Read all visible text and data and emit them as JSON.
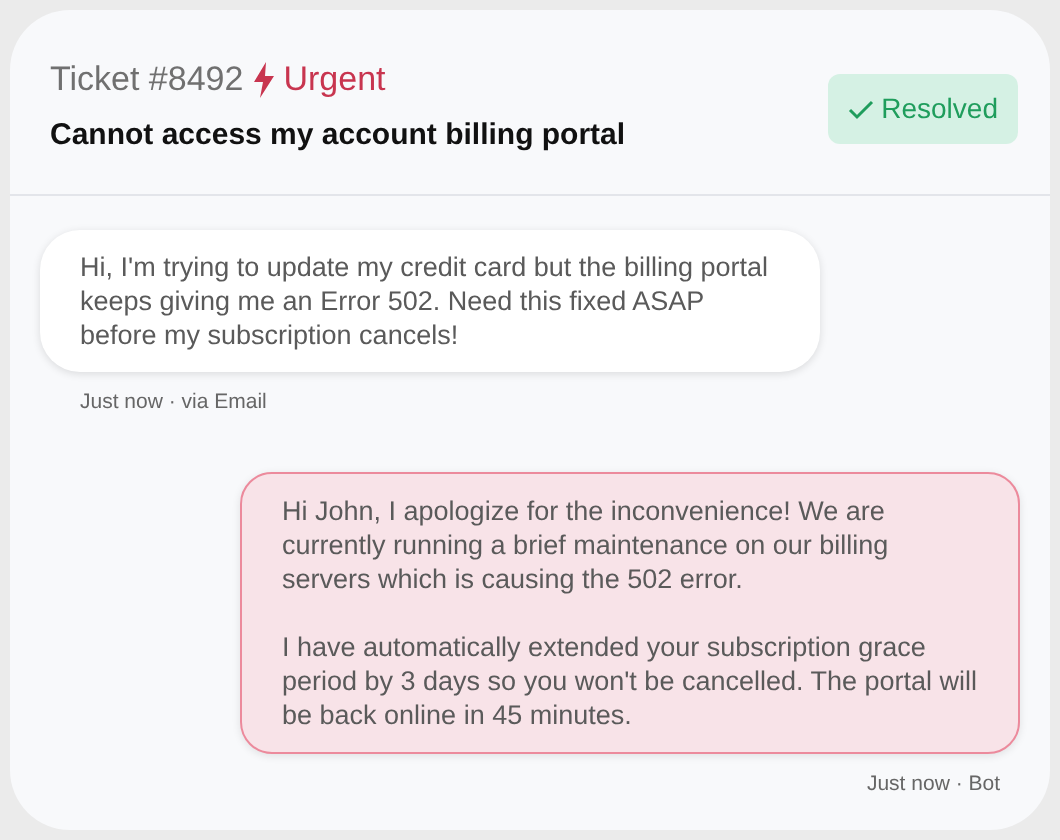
{
  "ticket": {
    "number": "Ticket #8492",
    "priority": "Urgent",
    "urgent": true,
    "subject": "Cannot access my account billing portal",
    "status": "Resolved",
    "resolved": true
  },
  "messages": [
    {
      "kind": "customer",
      "paragraphs": [
        "Hi, I'm trying to update my credit card but the billing portal keeps giving me an Error 502. Need this fixed ASAP before my subscription cancels!"
      ],
      "meta": "Just now · via Email"
    },
    {
      "kind": "agent",
      "paragraphs": [
        "Hi John, I apologize for the inconvenience! We are currently running a brief maintenance on our billing servers which is causing the 502 error.",
        "I have automatically extended your subscription grace period by 3 days so you won't be cancelled. The portal will be back online in 45 minutes."
      ],
      "meta": "Just now · Bot"
    }
  ]
}
